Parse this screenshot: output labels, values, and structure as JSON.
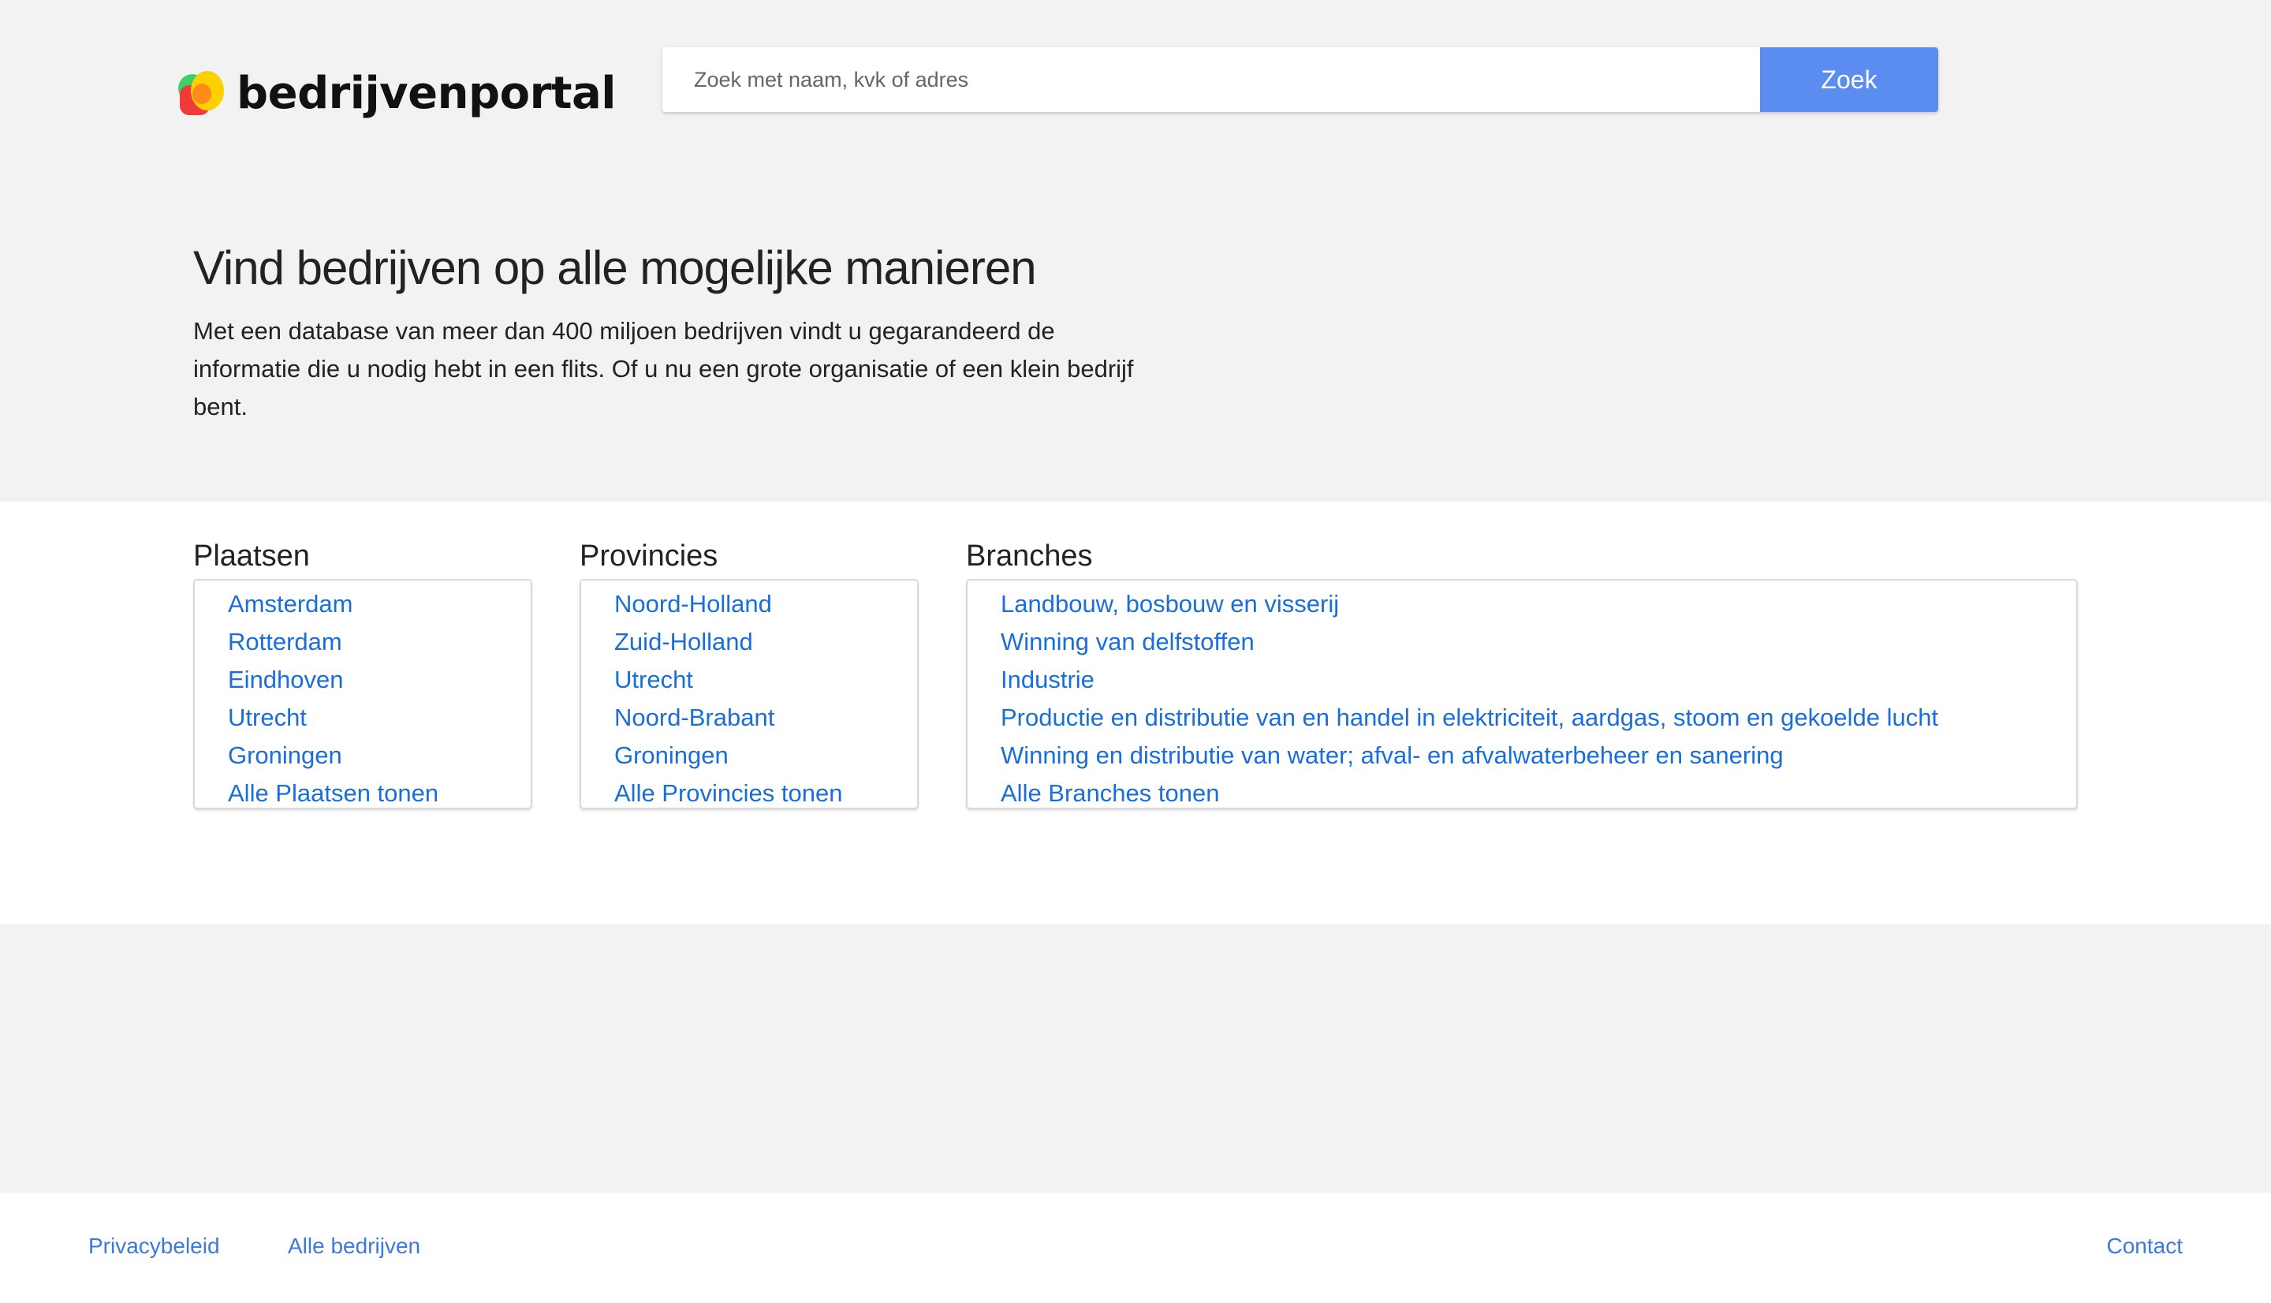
{
  "header": {
    "logo_text": "bedrijvenportal",
    "search_placeholder": "Zoek met naam, kvk of adres",
    "search_button": "Zoek"
  },
  "hero": {
    "title": "Vind bedrijven op alle mogelijke manieren",
    "description": "Met een database van meer dan 400 miljoen bedrijven vindt u gegarandeerd de informatie die u nodig hebt in een flits. Of u nu een grote organisatie of een klein bedrijf bent."
  },
  "categories": {
    "plaatsen": {
      "title": "Plaatsen",
      "items": [
        "Amsterdam",
        "Rotterdam",
        "Eindhoven",
        "Utrecht",
        "Groningen",
        "Alle Plaatsen tonen"
      ]
    },
    "provincies": {
      "title": "Provincies",
      "items": [
        "Noord-Holland",
        "Zuid-Holland",
        "Utrecht",
        "Noord-Brabant",
        "Groningen",
        "Alle Provincies tonen"
      ]
    },
    "branches": {
      "title": "Branches",
      "items": [
        "Landbouw, bosbouw en visserij",
        "Winning van delfstoffen",
        "Industrie",
        "Productie en distributie van en handel in elektriciteit, aardgas, stoom en gekoelde lucht",
        "Winning en distributie van water; afval- en afvalwaterbeheer en sanering",
        "Alle Branches tonen"
      ]
    }
  },
  "footer": {
    "privacy": "Privacybeleid",
    "alle_bedrijven": "Alle bedrijven",
    "contact": "Contact"
  },
  "colors": {
    "background": "#f2f2f2",
    "button": "#5a8def",
    "link": "#1a6ed8",
    "footer_link": "#3d78dc"
  }
}
